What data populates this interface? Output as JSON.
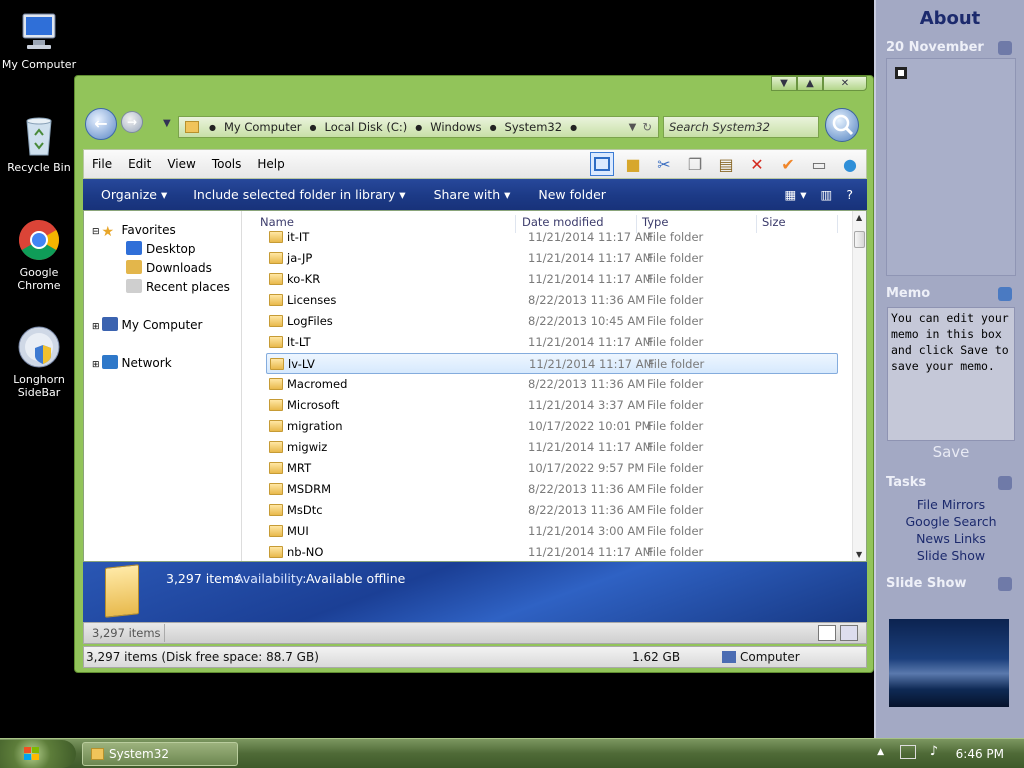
{
  "desktop": {
    "icons": [
      {
        "label": "My Computer"
      },
      {
        "label": "Recycle Bin"
      },
      {
        "label": "Google Chrome"
      },
      {
        "label": "Longhorn SideBar"
      }
    ]
  },
  "sidebar": {
    "title": "About",
    "date": "20 November",
    "memo_header": "Memo",
    "memo_text": "You can edit your memo in this box and click Save to save your memo.",
    "save_label": "Save",
    "tasks_header": "Tasks",
    "tasks": [
      "File Mirrors",
      "Google Search",
      "News Links",
      "Slide Show"
    ],
    "slideshow_header": "Slide Show"
  },
  "explorer": {
    "window_controls": [
      "▼",
      "▲",
      "✕"
    ],
    "breadcrumb": [
      "My Computer",
      "Local Disk (C:)",
      "Windows",
      "System32"
    ],
    "search_placeholder": "Search System32",
    "menu": [
      "File",
      "Edit",
      "View",
      "Tools",
      "Help"
    ],
    "commands": {
      "organize": "Organize ▾",
      "include": "Include selected folder in library ▾",
      "share": "Share with ▾",
      "new_folder": "New folder"
    },
    "nav": {
      "favorites": "Favorites",
      "desktop": "Desktop",
      "downloads": "Downloads",
      "recent": "Recent places",
      "my_computer": "My Computer",
      "network": "Network"
    },
    "columns": {
      "name": "Name",
      "date": "Date modified",
      "type": "Type",
      "size": "Size"
    },
    "files": [
      {
        "name": "it-IT",
        "date": "11/21/2014 11:17 AM",
        "type": "File folder"
      },
      {
        "name": "ja-JP",
        "date": "11/21/2014 11:17 AM",
        "type": "File folder"
      },
      {
        "name": "ko-KR",
        "date": "11/21/2014 11:17 AM",
        "type": "File folder"
      },
      {
        "name": "Licenses",
        "date": "8/22/2013 11:36 AM",
        "type": "File folder"
      },
      {
        "name": "LogFiles",
        "date": "8/22/2013 10:45 AM",
        "type": "File folder"
      },
      {
        "name": "lt-LT",
        "date": "11/21/2014 11:17 AM",
        "type": "File folder"
      },
      {
        "name": "lv-LV",
        "date": "11/21/2014 11:17 AM",
        "type": "File folder",
        "selected": true
      },
      {
        "name": "Macromed",
        "date": "8/22/2013 11:36 AM",
        "type": "File folder"
      },
      {
        "name": "Microsoft",
        "date": "11/21/2014 3:37 AM",
        "type": "File folder"
      },
      {
        "name": "migration",
        "date": "10/17/2022 10:01 PM",
        "type": "File folder"
      },
      {
        "name": "migwiz",
        "date": "11/21/2014 11:17 AM",
        "type": "File folder"
      },
      {
        "name": "MRT",
        "date": "10/17/2022 9:57 PM",
        "type": "File folder"
      },
      {
        "name": "MSDRM",
        "date": "8/22/2013 11:36 AM",
        "type": "File folder"
      },
      {
        "name": "MsDtc",
        "date": "8/22/2013 11:36 AM",
        "type": "File folder"
      },
      {
        "name": "MUI",
        "date": "11/21/2014 3:00 AM",
        "type": "File folder"
      },
      {
        "name": "nb-NO",
        "date": "11/21/2014 11:17 AM",
        "type": "File folder"
      }
    ],
    "details": {
      "count": "3,297 items",
      "availability_label": "Availability:",
      "availability_value": "Available offline"
    },
    "status1": "3,297 items",
    "status2": {
      "left": "3,297 items (Disk free space: 88.7 GB)",
      "size": "1.62 GB",
      "location": "Computer"
    }
  },
  "taskbar": {
    "task_label": "System32",
    "clock": "6:46 PM"
  }
}
